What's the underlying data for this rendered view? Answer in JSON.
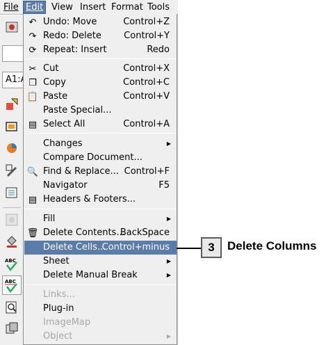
{
  "menubar": {
    "file": "File",
    "edit": "Edit",
    "view": "View",
    "insert": "Insert",
    "format": "Format",
    "tools": "Tools"
  },
  "toolbar": {
    "cell_ref": "A1:A"
  },
  "edit_menu": {
    "undo": {
      "label": "Undo: Move",
      "accel": "Control+Z"
    },
    "redo": {
      "label": "Redo: Delete",
      "accel": "Control+Y"
    },
    "repeat": {
      "label": "Repeat: Insert",
      "accel": "Redo"
    },
    "cut": {
      "label": "Cut",
      "accel": "Control+X"
    },
    "copy": {
      "label": "Copy",
      "accel": "Control+C"
    },
    "paste": {
      "label": "Paste",
      "accel": "Control+V"
    },
    "paste_special": {
      "label": "Paste Special..."
    },
    "select_all": {
      "label": "Select All",
      "accel": "Control+A"
    },
    "changes": {
      "label": "Changes"
    },
    "compare_document": {
      "label": "Compare Document..."
    },
    "find_replace": {
      "label": "Find & Replace...",
      "accel": "Control+F"
    },
    "navigator": {
      "label": "Navigator",
      "accel": "F5"
    },
    "headers_footers": {
      "label": "Headers & Footers..."
    },
    "fill": {
      "label": "Fill"
    },
    "delete_contents": {
      "label": "Delete Contents...",
      "accel": "BackSpace"
    },
    "delete_cells": {
      "label": "Delete Cells...",
      "accel": "Control+minus"
    },
    "sheet": {
      "label": "Sheet"
    },
    "delete_manual_break": {
      "label": "Delete Manual Break"
    },
    "links": {
      "label": "Links..."
    },
    "plugin": {
      "label": "Plug-in"
    },
    "imagemap": {
      "label": "ImageMap"
    },
    "object": {
      "label": "Object"
    }
  },
  "callout": {
    "number": "3",
    "text": "Delete Columns"
  },
  "colors": {
    "highlight": "#5b7ba8",
    "disabled": "#a7a7a7",
    "menu_bg": "#efefef"
  }
}
